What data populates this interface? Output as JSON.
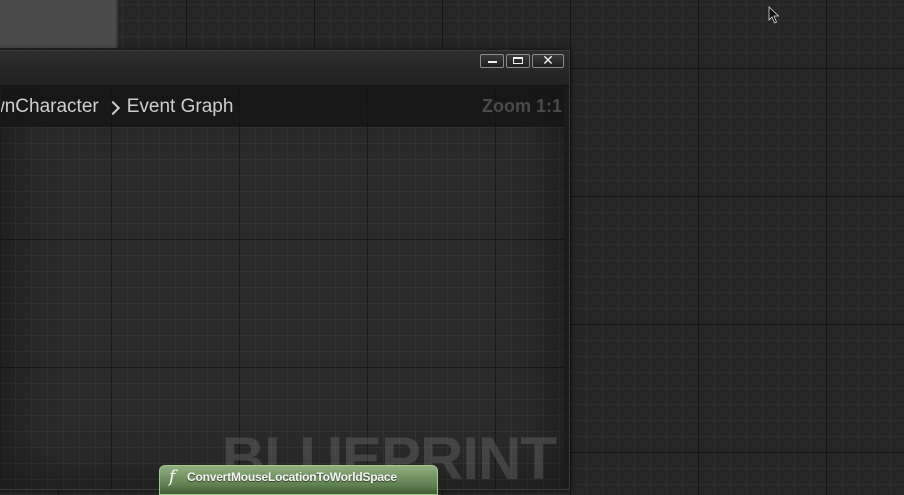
{
  "window": {
    "controls": {
      "minimize_icon": "minimize-icon",
      "maximize_icon": "maximize-icon",
      "close_glyph": "✕"
    }
  },
  "breadcrumb": {
    "items": [
      {
        "label": "wnCharacter"
      },
      {
        "label": "Event Graph"
      }
    ],
    "separator_icon": "chevron-right-icon"
  },
  "graph": {
    "zoom_label": "Zoom 1:1",
    "watermark": "BLUEPRINT"
  },
  "node": {
    "icon": "f",
    "title": "ConvertMouseLocationToWorldSpace",
    "color": "#6e8f5e"
  },
  "colors": {
    "background": "#262626",
    "window_bg": "#1b1b1b",
    "text": "#cfcfcf"
  }
}
